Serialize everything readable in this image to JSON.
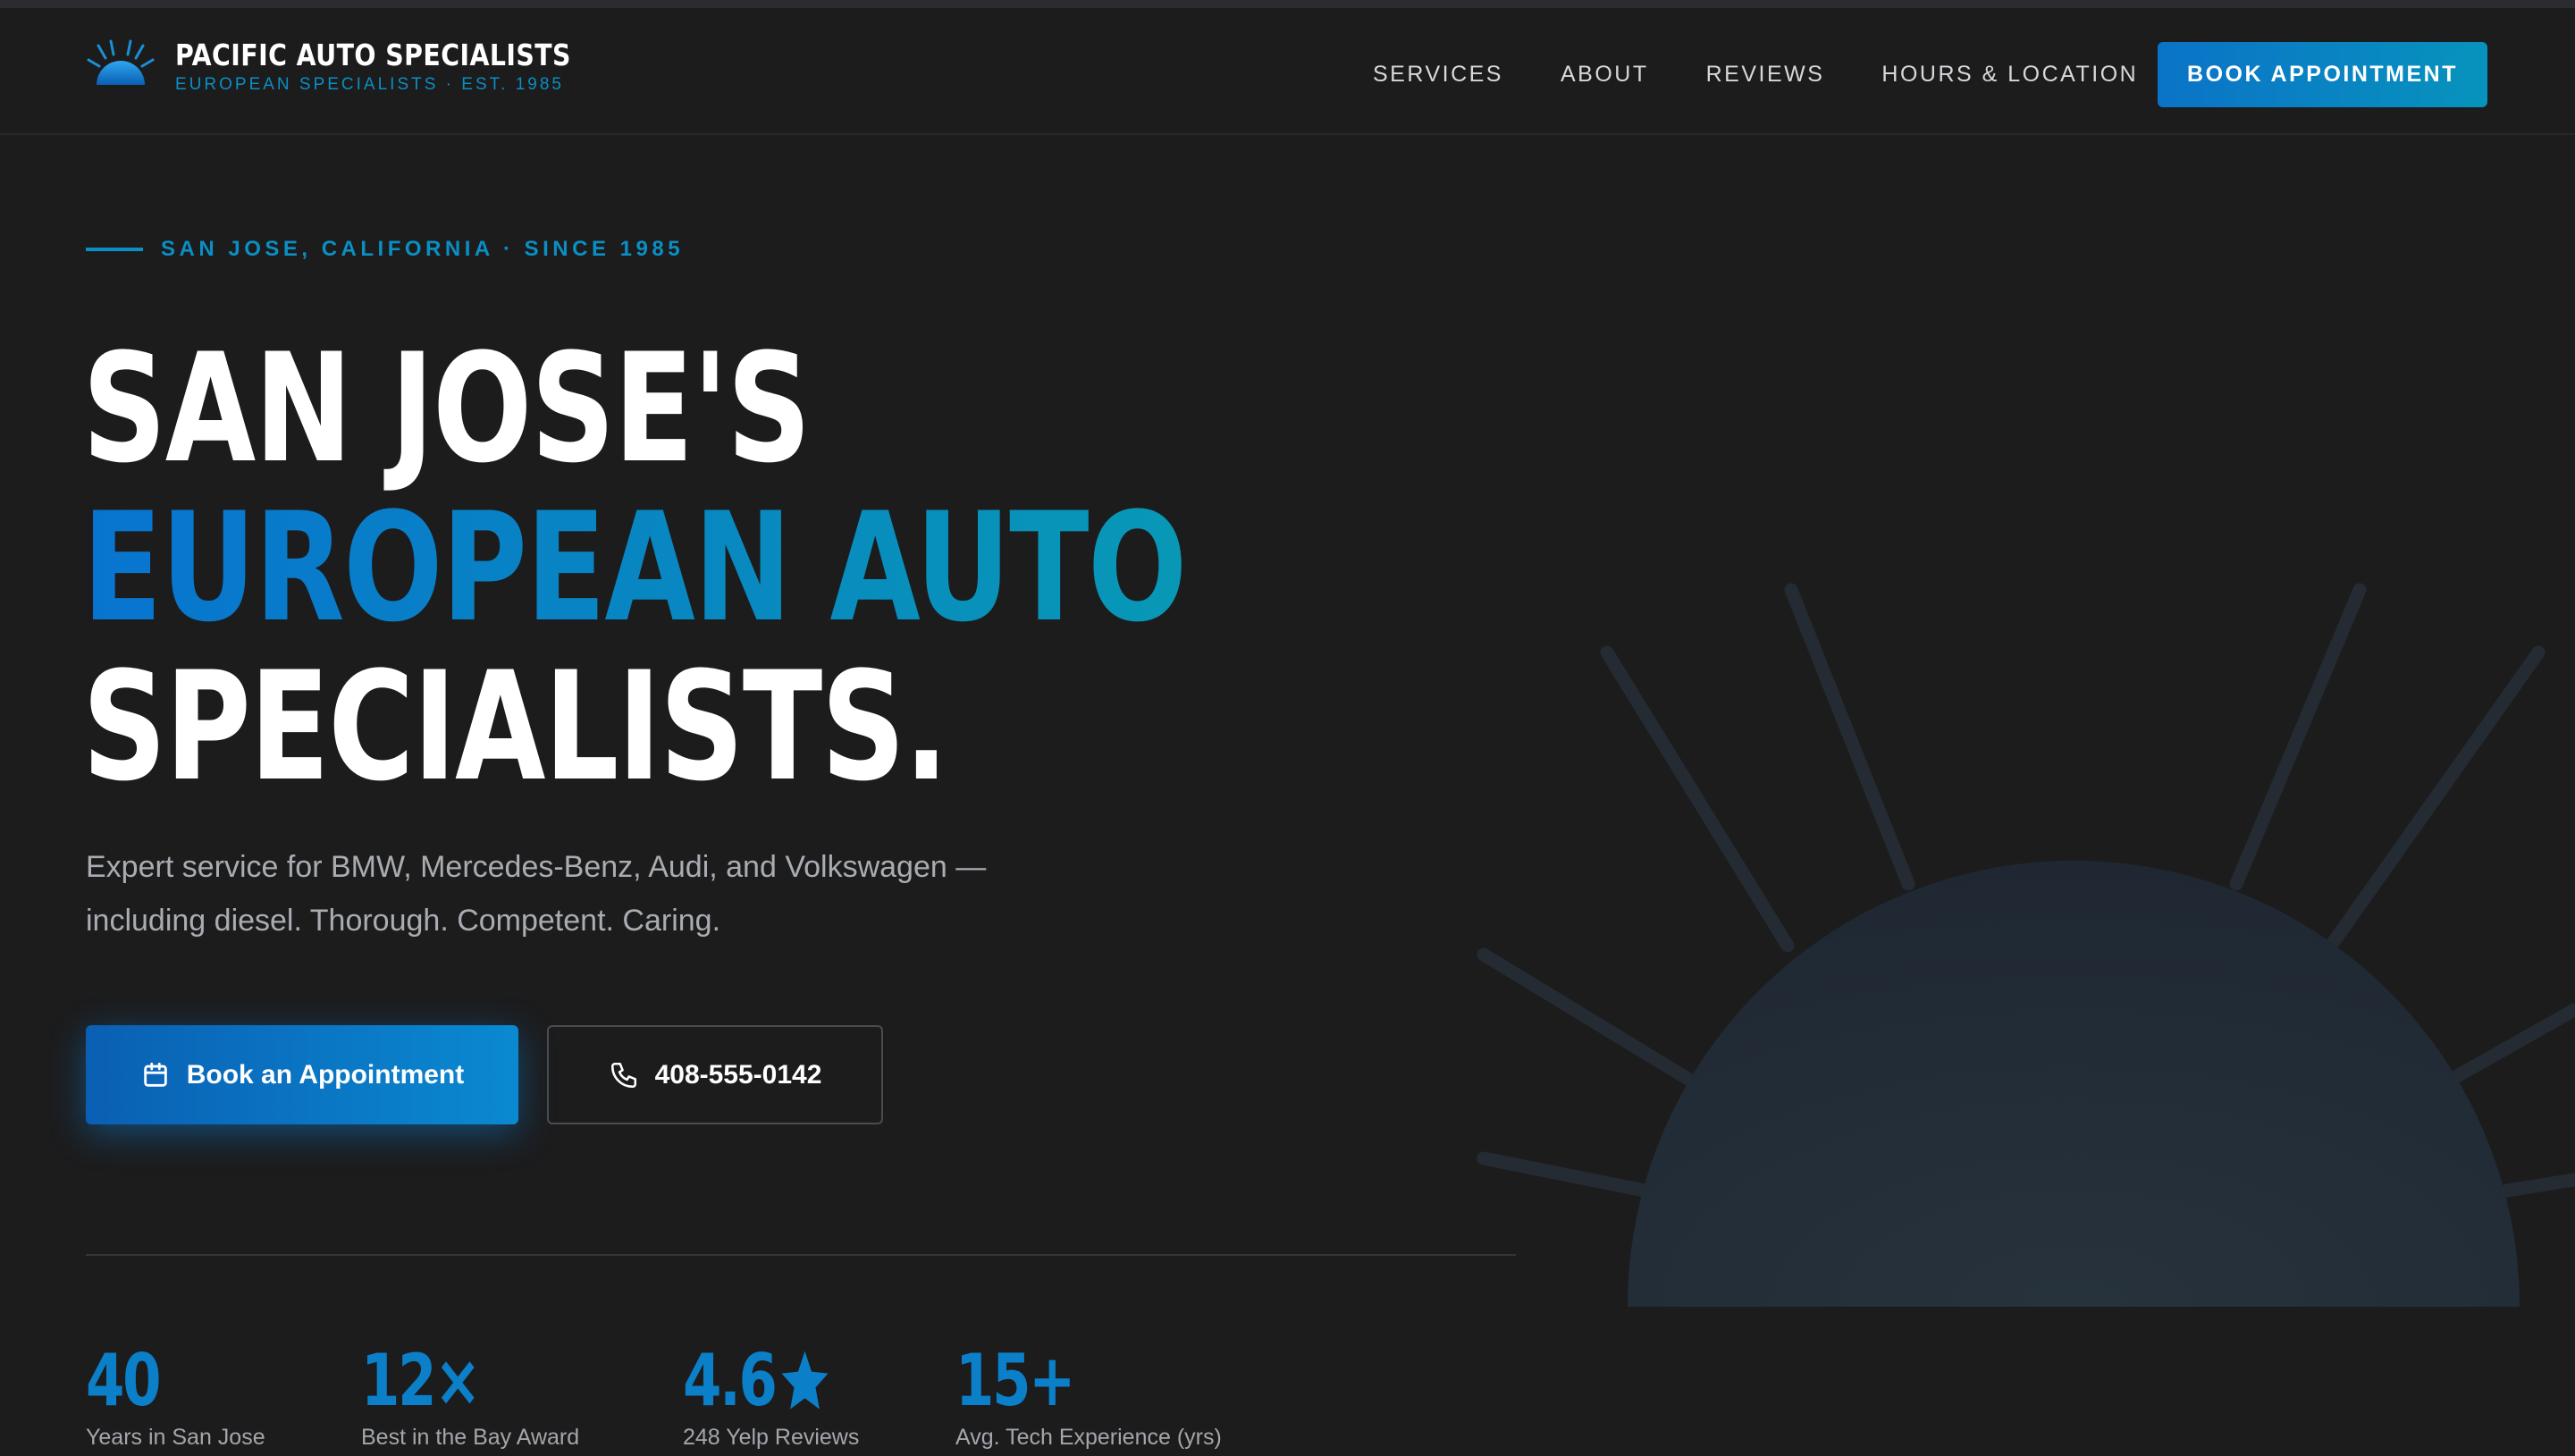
{
  "header": {
    "brand_name": "PACIFIC AUTO SPECIALISTS",
    "brand_tagline": "EUROPEAN SPECIALISTS · EST. 1985",
    "nav": [
      "SERVICES",
      "ABOUT",
      "REVIEWS",
      "HOURS & LOCATION"
    ],
    "cta_label": "BOOK APPOINTMENT"
  },
  "hero": {
    "eyebrow": "SAN JOSE, CALIFORNIA · SINCE 1985",
    "headline_line1": "SAN JOSE'S",
    "headline_line2": "EUROPEAN AUTO",
    "headline_line3": "SPECIALISTS.",
    "lead": "Expert service for BMW, Mercedes-Benz, Audi, and Volkswagen — including diesel. Thorough. Competent. Caring.",
    "primary_button": "Book an Appointment",
    "primary_button_icon": "calendar-icon",
    "secondary_button": "408-555-0142",
    "secondary_button_icon": "phone-icon"
  },
  "stats": [
    {
      "value": "40",
      "label": "Years in San Jose"
    },
    {
      "value": "12×",
      "label": "Best in the Bay Award"
    },
    {
      "value": "4.6",
      "label": "248 Yelp Reviews",
      "icon": "star-icon"
    },
    {
      "value": "15+",
      "label": "Avg. Tech Experience (yrs)"
    }
  ],
  "colors": {
    "background": "#1c1c1d",
    "accent_blue": "#0b7fc8",
    "accent_teal": "#0898b6",
    "text_muted": "#a9adb2"
  }
}
